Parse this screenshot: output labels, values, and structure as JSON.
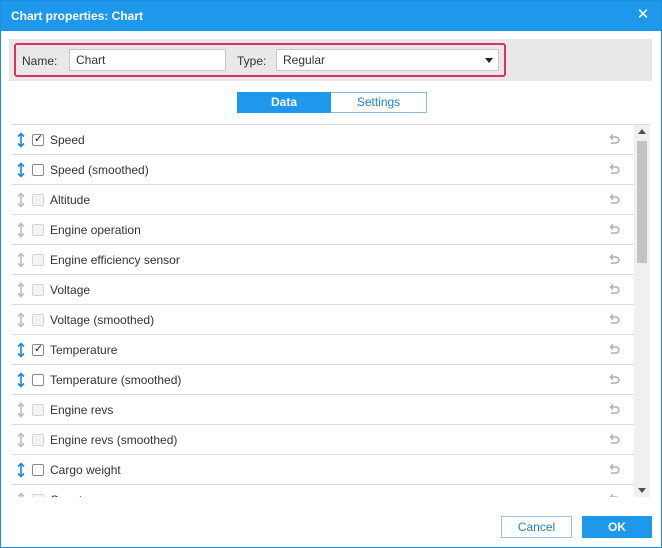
{
  "window": {
    "title": "Chart properties: Chart",
    "close_icon": "close-icon"
  },
  "properties": {
    "name_label": "Name:",
    "name_value": "Chart",
    "type_label": "Type:",
    "type_value": "Regular"
  },
  "tabs": [
    {
      "label": "Data",
      "active": true
    },
    {
      "label": "Settings",
      "active": false
    }
  ],
  "items": [
    {
      "label": "Speed",
      "checked": true,
      "enabled": true
    },
    {
      "label": "Speed (smoothed)",
      "checked": false,
      "enabled": true
    },
    {
      "label": "Altitude",
      "checked": false,
      "enabled": false
    },
    {
      "label": "Engine operation",
      "checked": false,
      "enabled": false
    },
    {
      "label": "Engine efficiency sensor",
      "checked": false,
      "enabled": false
    },
    {
      "label": "Voltage",
      "checked": false,
      "enabled": false
    },
    {
      "label": "Voltage (smoothed)",
      "checked": false,
      "enabled": false
    },
    {
      "label": "Temperature",
      "checked": true,
      "enabled": true
    },
    {
      "label": "Temperature (smoothed)",
      "checked": false,
      "enabled": true
    },
    {
      "label": "Engine revs",
      "checked": false,
      "enabled": false
    },
    {
      "label": "Engine revs (smoothed)",
      "checked": false,
      "enabled": false
    },
    {
      "label": "Cargo weight",
      "checked": false,
      "enabled": true
    },
    {
      "label": "Counter sensors",
      "checked": false,
      "enabled": false
    }
  ],
  "footer": {
    "cancel_label": "Cancel",
    "ok_label": "OK"
  },
  "colors": {
    "accent": "#1e98ea",
    "highlight_border": "#e03060",
    "drag_active": "#1e88d8",
    "drag_inactive": "#bdbdbd",
    "reset_icon": "#b0b0b0"
  }
}
